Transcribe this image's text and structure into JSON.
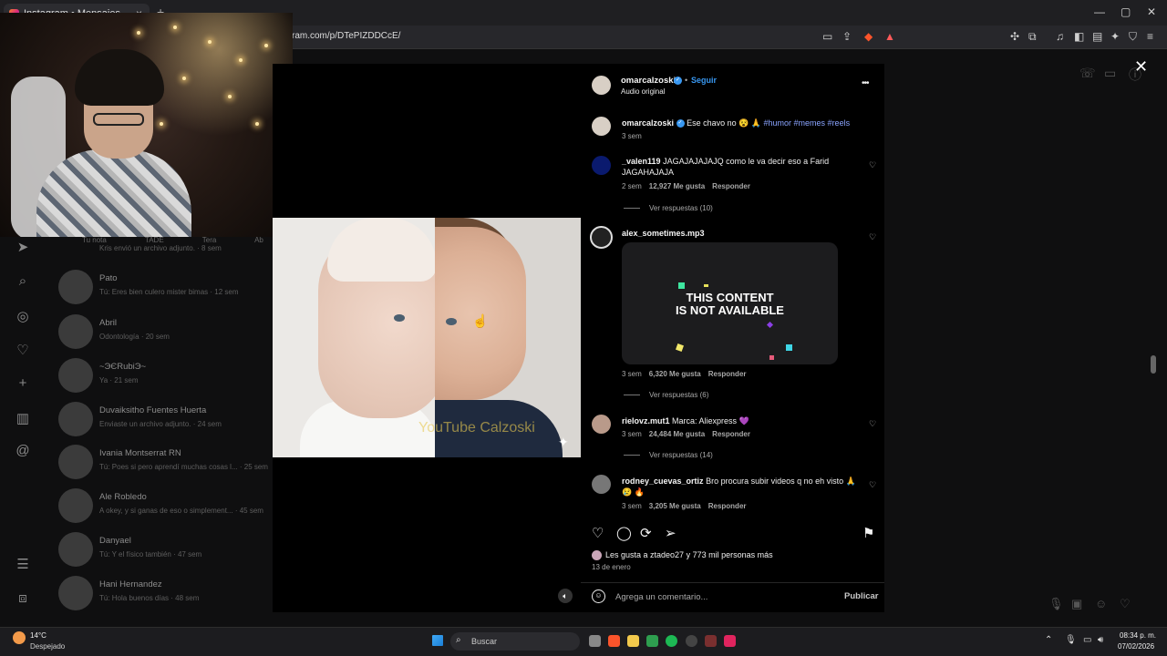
{
  "browser": {
    "tab_title": "Instagram • Mensajes",
    "tab_close": "×",
    "new_tab": "+",
    "url": "ram.com/p/DTePIZDDCcE/",
    "window_controls": [
      "—",
      "▢",
      "✕"
    ]
  },
  "messages_page": {
    "tabs": [
      "Tu nota",
      "TADE",
      "Tera",
      "Ab"
    ],
    "chats": [
      {
        "name": "",
        "preview": "Kris envió un archivo adjunto. · 8 sem"
      },
      {
        "name": "Pato",
        "preview": "Tú: Eres bien culero mister bimas · 12 sem"
      },
      {
        "name": "Abril",
        "preview": "Odontología · 20 sem"
      },
      {
        "name": "~ЭЄRubiЭ~",
        "preview": "Ya · 21 sem"
      },
      {
        "name": "Duvaiksitho Fuentes Huerta",
        "preview": "Enviaste un archivo adjunto. · 24 sem"
      },
      {
        "name": "Ivania Montserrat RN",
        "preview": "Tú: Poes si pero aprendí muchas cosas l... · 25 sem"
      },
      {
        "name": "Ale Robledo",
        "preview": "A okey, y si ganas de eso o simplement... · 45 sem"
      },
      {
        "name": "Danyael",
        "preview": "Tú: Y el físico también · 47 sem"
      },
      {
        "name": "Hani Hernandez",
        "preview": "Tú: Hola buenos días · 48 sem"
      }
    ]
  },
  "video": {
    "watermark": "YouTube Calzoski"
  },
  "post": {
    "author": "omarcalzoski",
    "follow": "Seguir",
    "audio": "Audio original",
    "more": "•••",
    "caption_text": "Ese chavo no 😵 🙏",
    "caption_tags": "#humor #memes #reels",
    "caption_time": "3 sem",
    "comments": [
      {
        "user": "_valen119",
        "text": "JAGAJAJAJAJQ como le va decir eso a Farid JAGAHAJAJA",
        "time": "2 sem",
        "likes": "12,927 Me gusta",
        "reply": "Responder",
        "replies": "Ver respuestas (10)"
      },
      {
        "user": "alex_sometimes.mp3",
        "text": "",
        "time": "3 sem",
        "likes": "6,320 Me gusta",
        "reply": "Responder",
        "replies": "Ver respuestas (6)",
        "media_text": "THIS CONTENT\nIS NOT AVAILABLE"
      },
      {
        "user": "rielovz.mut1",
        "text": "Marca: Aliexpress 💜",
        "time": "3 sem",
        "likes": "24,484 Me gusta",
        "reply": "Responder",
        "replies": "Ver respuestas (14)"
      },
      {
        "user": "rodney_cuevas_ortiz",
        "text": "Bro procura subir videos q no eh visto 🙏 😢 🔥",
        "time": "3 sem",
        "likes": "3,205 Me gusta",
        "reply": "Responder"
      }
    ],
    "likes_line": "Les gusta a ztadeo27 y 773 mil personas más",
    "date": "13 de enero",
    "comment_placeholder": "Agrega un comentario...",
    "publish": "Publicar"
  },
  "taskbar": {
    "temp": "14°C",
    "weather": "Despejado",
    "search": "Buscar",
    "time": "08:34 p. m.",
    "date": "07/02/2026"
  },
  "colors": {
    "link_blue": "#3897f0",
    "hashtag": "#8aa4ff",
    "panel_bg": "#000000"
  }
}
